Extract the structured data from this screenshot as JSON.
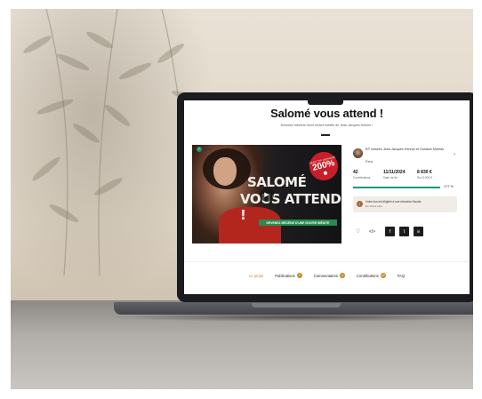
{
  "page": {
    "title": "Salomé vous attend !",
    "subtitle": "Devenez mécène d'une œuvre inédite de Jean-Jacques Henner !"
  },
  "badge": {
    "label": "Nouv",
    "icon": "check-icon"
  },
  "hero": {
    "title_line1": "SALOMÉ",
    "title_line2": "VOUS ATTEND !",
    "banner": "DEVENEZ MÉCÈNE D'UNE ŒUVRE INÉDITE",
    "sticker_top": "OBJECTIF DÉPASSÉ",
    "sticker_percent": "200%",
    "play_icon": "play-icon"
  },
  "creator": {
    "name": "EP musées Jean-Jacques Henner et Gustave Moreau",
    "city": "Paris"
  },
  "stats": {
    "contributions_value": "42",
    "contributions_label": "Contributions",
    "date_value": "11/11/2024",
    "date_label": "Date de fin",
    "amount_value": "8 830 €",
    "amount_label": "Sur 5 000 €"
  },
  "progress": {
    "percent": 177,
    "label": "177 %"
  },
  "info": {
    "text": "Votre don est éligible à une réduction fiscale",
    "subtext": "En savoir plus"
  },
  "tabs": [
    {
      "label": "Le projet",
      "count": ""
    },
    {
      "label": "Publications",
      "count": "2"
    },
    {
      "label": "Commentaires",
      "count": "6"
    },
    {
      "label": "Contributions",
      "count": "42"
    },
    {
      "label": "FAQ",
      "count": ""
    }
  ],
  "share": {
    "embed_label": "</>",
    "facebook_label": "f",
    "twitter_label": "t",
    "linkedin_label": "in"
  },
  "colors": {
    "accent": "#c48a2a",
    "progress": "#1c9b6a",
    "sticker": "#c81e2a",
    "banner": "#2a8a4f"
  }
}
